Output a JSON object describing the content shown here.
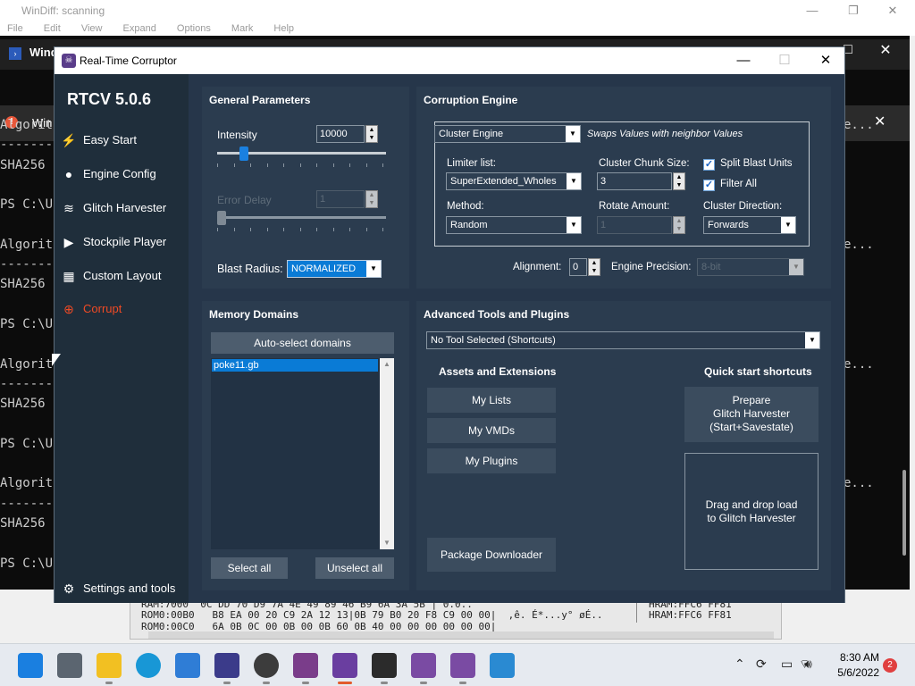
{
  "windiff": {
    "title": "WinDiff: scanning",
    "menu": [
      "File",
      "Edit",
      "View",
      "Expand",
      "Options",
      "Mark",
      "Help"
    ],
    "hex_lines": [
      "RAM:7000  0C DD 70 D9 7A 4E 49 89 46 B9 6A 3A 5B | 0.0..",
      "ROM0:00B0   B8 EA 00 20 C9 2A 12 13|0B 79 B0 20 F8 C9 00 00|  ,ê. É*...y° øÉ..",
      "ROM0:00C0   6A 0B 0C 00 0B 00 0B 60 0B 40 00 00 00 00 00 00|"
    ],
    "hex_right": [
      "HRAM:FFC6 FF81",
      "HRAM:FFC6 FF81",
      "HRAM:FFC6 FF81"
    ]
  },
  "terminal": {
    "tab1_label": "Wind",
    "tab2_label": "Win",
    "lines": [
      {
        "text": "Algorit",
        "ellipsis": "e..."
      },
      {
        "text": "-------",
        "ellipsis": ""
      },
      {
        "text": "SHA256",
        "ellipsis": ""
      },
      {
        "text": "",
        "ellipsis": ""
      },
      {
        "text": "PS C:\\U",
        "ellipsis": ""
      },
      {
        "text": "",
        "ellipsis": ""
      },
      {
        "text": "Algorit",
        "ellipsis": "e..."
      },
      {
        "text": "-------",
        "ellipsis": ""
      },
      {
        "text": "SHA256",
        "ellipsis": ""
      },
      {
        "text": "",
        "ellipsis": ""
      },
      {
        "text": "PS C:\\U",
        "ellipsis": ""
      },
      {
        "text": "",
        "ellipsis": ""
      },
      {
        "text": "Algorit",
        "ellipsis": "e..."
      },
      {
        "text": "-------",
        "ellipsis": ""
      },
      {
        "text": "SHA256",
        "ellipsis": ""
      },
      {
        "text": "",
        "ellipsis": ""
      },
      {
        "text": "PS C:\\U",
        "ellipsis": ""
      },
      {
        "text": "",
        "ellipsis": ""
      },
      {
        "text": "Algorit",
        "ellipsis": "e..."
      },
      {
        "text": "-------",
        "ellipsis": ""
      },
      {
        "text": "SHA256",
        "ellipsis": ""
      },
      {
        "text": "",
        "ellipsis": ""
      },
      {
        "text": "PS C:\\U",
        "ellipsis": ""
      }
    ]
  },
  "rtc": {
    "window_title": "Real-Time Corruptor",
    "version": "RTCV 5.0.6",
    "nav": [
      {
        "label": "Easy Start",
        "icon": "wand-icon",
        "active": false
      },
      {
        "label": "Engine Config",
        "icon": "palette-icon",
        "active": false
      },
      {
        "label": "Glitch Harvester",
        "icon": "layers-icon",
        "active": false
      },
      {
        "label": "Stockpile Player",
        "icon": "play-icon",
        "active": false
      },
      {
        "label": "Custom Layout",
        "icon": "grid-icon",
        "active": false
      },
      {
        "label": "Corrupt",
        "icon": "crosshair-icon",
        "active": true
      }
    ],
    "settings_label": "Settings and tools",
    "general": {
      "title": "General Parameters",
      "intensity_label": "Intensity",
      "intensity_value": "10000",
      "intensity_level": 0.14,
      "error_delay_label": "Error Delay",
      "error_delay_value": "1",
      "error_delay_level": 0.0,
      "blast_radius_label": "Blast Radius:",
      "blast_radius_value": "NORMALIZED"
    },
    "engine": {
      "title": "Corruption Engine",
      "engine_value": "Cluster Engine",
      "engine_desc": "Swaps Values with neighbor Values",
      "limiter_label": "Limiter list:",
      "limiter_value": "SuperExtended_Wholes",
      "chunk_label": "Cluster Chunk Size:",
      "chunk_value": "3",
      "split_label": "Split Blast Units",
      "split_checked": true,
      "filter_label": "Filter All",
      "filter_checked": true,
      "method_label": "Method:",
      "method_value": "Random",
      "rotate_label": "Rotate Amount:",
      "rotate_value": "1",
      "direction_label": "Cluster Direction:",
      "direction_value": "Forwards",
      "alignment_label": "Alignment:",
      "alignment_value": "0",
      "precision_label": "Engine Precision:",
      "precision_value": "8-bit"
    },
    "memory": {
      "title": "Memory Domains",
      "auto_button": "Auto-select domains",
      "items": [
        "poke11.gb"
      ],
      "select_all": "Select all",
      "unselect_all": "Unselect all"
    },
    "advanced": {
      "title": "Advanced Tools and Plugins",
      "tool_value": "No Tool Selected (Shortcuts)",
      "assets_title": "Assets and Extensions",
      "buttons": [
        "My Lists",
        "My VMDs",
        "My Plugins"
      ],
      "package_button": "Package Downloader",
      "quick_title": "Quick start shortcuts",
      "prepare_lines": [
        "Prepare",
        "Glitch Harvester",
        "(Start+Savestate)"
      ],
      "drag_lines": [
        "Drag and drop load",
        "to Glitch Harvester"
      ]
    }
  },
  "taskbar": {
    "time": "8:30 AM",
    "date": "5/6/2022",
    "notification_count": "2",
    "icons": [
      "start-icon",
      "task-view-icon",
      "file-explorer-icon",
      "edge-icon",
      "store-icon",
      "app-icon",
      "gamepad-icon",
      "notes-icon",
      "rtc-icon",
      "terminal-icon",
      "app2-icon",
      "app3-icon",
      "notepad-icon"
    ],
    "tray_icons": [
      "chevron-up-icon",
      "sync-icon",
      "display-icon",
      "wifi-icon",
      "volume-icon"
    ]
  },
  "colors": {
    "rtc_bg": "#26364a",
    "rtc_side": "#1f2e3b",
    "accent_corrupt": "#f04a24",
    "selection": "#0a7bd6",
    "badge": "#e04040"
  }
}
